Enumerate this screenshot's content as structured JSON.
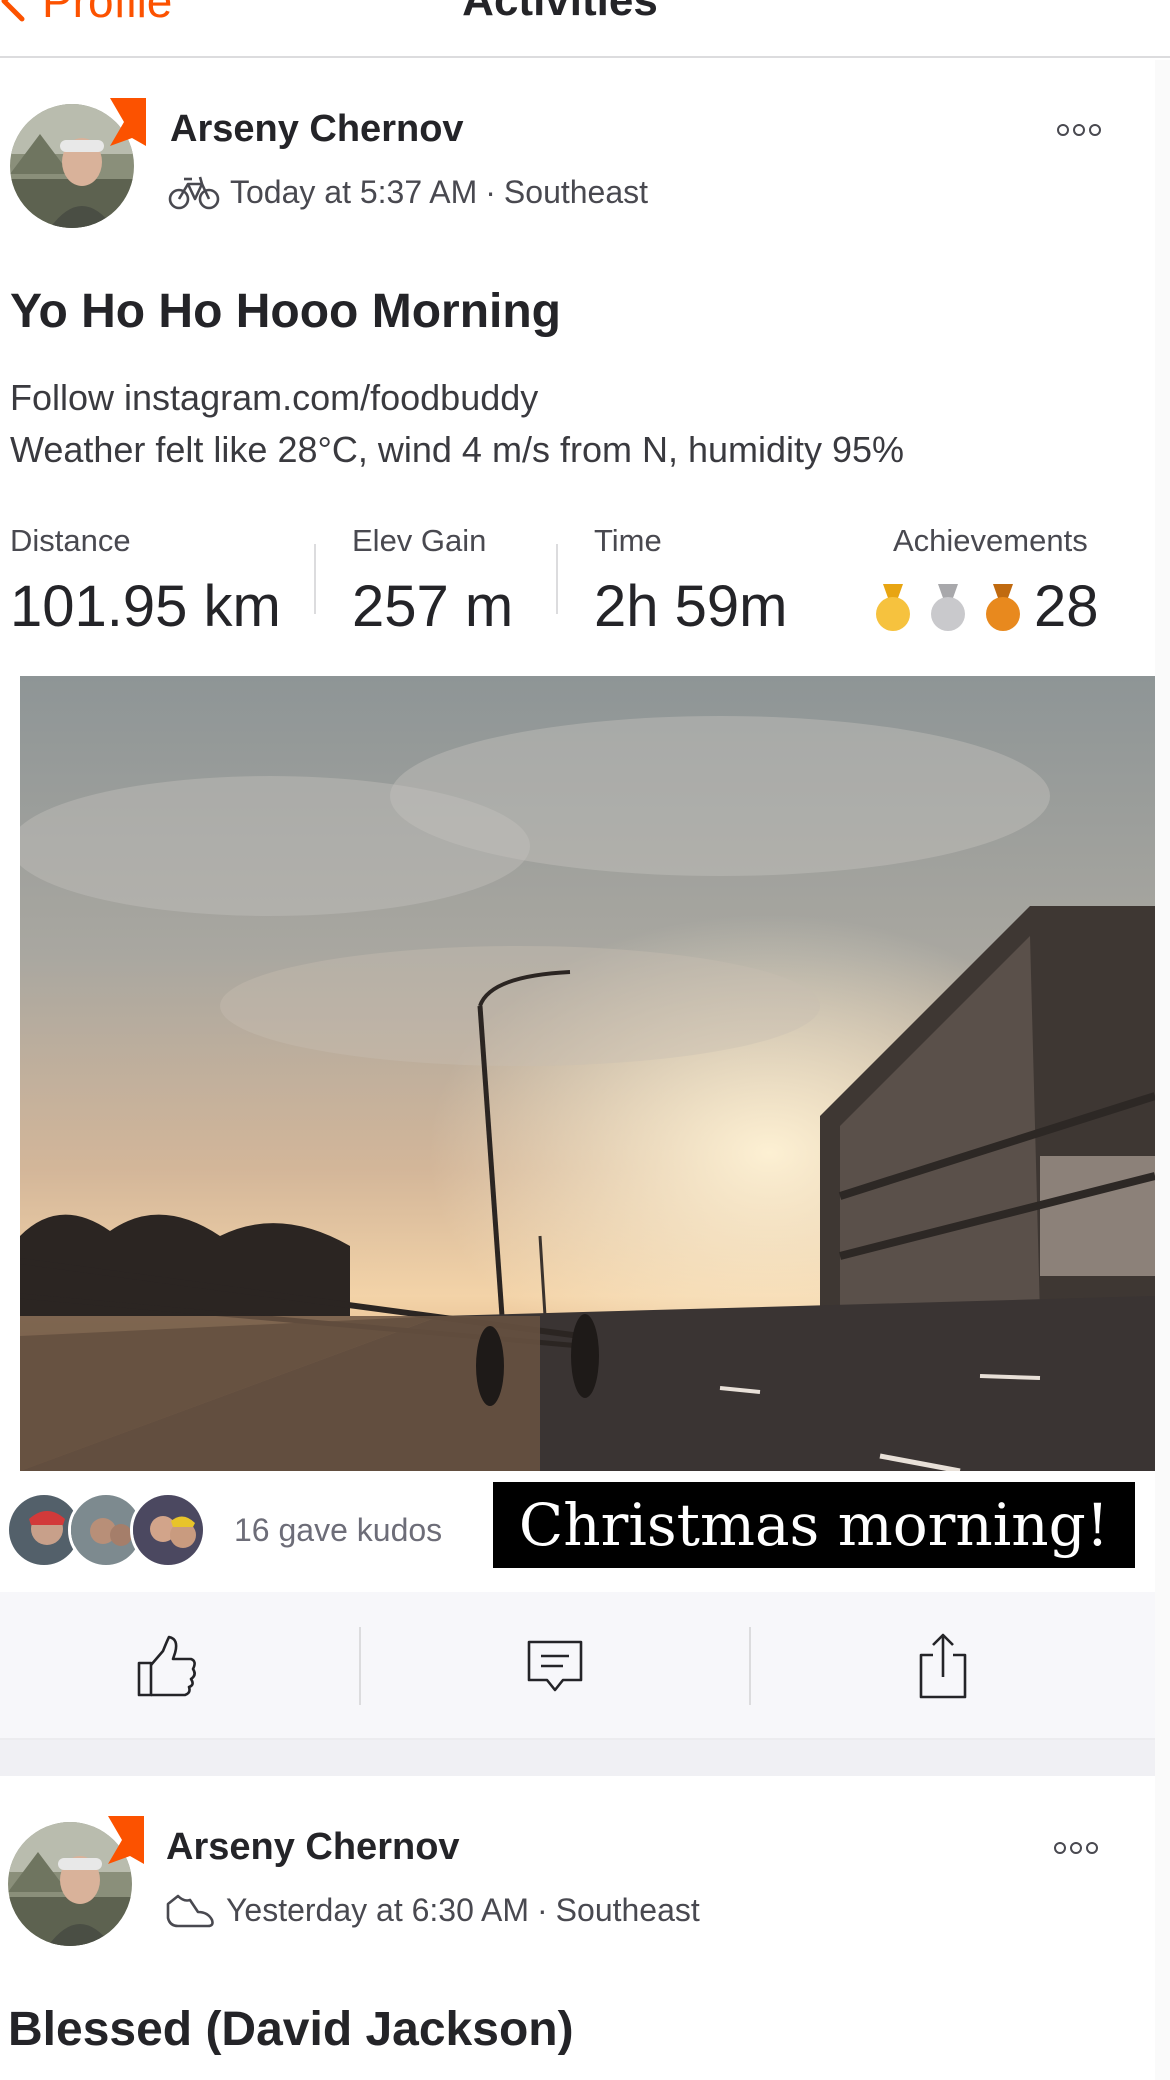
{
  "nav": {
    "back_label": "Profile",
    "title": "Activities"
  },
  "posts": [
    {
      "athlete_name": "Arseny Chernov",
      "activity_icon": "bike-icon",
      "timestamp": "Today at 5:37 AM",
      "separator": "·",
      "location": "Southeast",
      "title": "Yo Ho Ho Hooo Morning",
      "description_line1": "Follow instagram.com/foodbuddy",
      "description_line2": "Weather felt like 28°C, wind 4 m/s from N, humidity 95%",
      "stats": {
        "distance_label": "Distance",
        "distance_value": "101.95 km",
        "elev_label": "Elev Gain",
        "elev_value": "257 m",
        "time_label": "Time",
        "time_value": "2h 59m",
        "achievements_label": "Achievements",
        "achievements_value": "28",
        "medals": [
          "gold-medal-icon",
          "silver-medal-icon",
          "bronze-medal-icon"
        ]
      },
      "kudos_text": "16 gave kudos",
      "photo_caption": "Christmas morning!"
    },
    {
      "athlete_name": "Arseny Chernov",
      "activity_icon": "shoe-icon",
      "timestamp": "Yesterday at 6:30 AM",
      "separator": "·",
      "location": "Southeast",
      "title": "Blessed (David Jackson)"
    }
  ],
  "actions": [
    "kudos-thumb-icon",
    "comment-icon",
    "share-icon"
  ],
  "colors": {
    "brand": "#fc5200",
    "gold": "#f6c23e",
    "silver": "#c9c9cc",
    "bronze": "#e8891e"
  }
}
